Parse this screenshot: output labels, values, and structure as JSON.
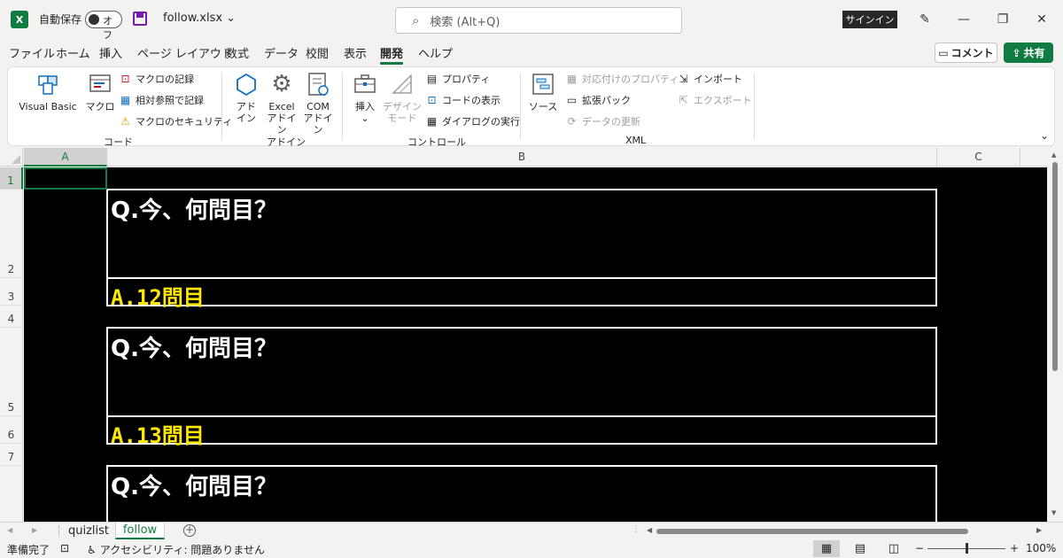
{
  "title": {
    "autosave_label": "自動保存",
    "autosave_state": "オフ",
    "filename": "follow.xlsx",
    "search_placeholder": "検索 (Alt+Q)",
    "signin": "サインイン"
  },
  "menu": {
    "tabs": [
      "ファイル",
      "ホーム",
      "挿入",
      "ページ レイアウト",
      "数式",
      "データ",
      "校閲",
      "表示",
      "開発",
      "ヘルプ"
    ],
    "active_tab": "開発",
    "comment": "コメント",
    "share": "共有"
  },
  "ribbon": {
    "code": {
      "label": "コード",
      "visual_basic": "Visual Basic",
      "macro": "マクロ",
      "record_macro": "マクロの記録",
      "relative_ref": "相対参照で記録",
      "macro_security": "マクロのセキュリティ"
    },
    "addins": {
      "label": "アドイン",
      "addin_line1": "アド",
      "addin_line2": "イン",
      "excel_line1": "Excel",
      "excel_line2": "アドイン",
      "com_line1": "COM",
      "com_line2": "アドイン"
    },
    "controls": {
      "label": "コントロール",
      "insert": "挿入",
      "design_line1": "デザイン",
      "design_line2": "モード",
      "properties": "プロパティ",
      "view_code": "コードの表示",
      "run_dialog": "ダイアログの実行"
    },
    "xml": {
      "label": "XML",
      "source": "ソース",
      "map_properties": "対応付けのプロパティ",
      "expansion_packs": "拡張パック",
      "refresh_data": "データの更新",
      "import": "インポート",
      "export": "エクスポート"
    }
  },
  "grid": {
    "columns": [
      "A",
      "B",
      "C"
    ],
    "rows": [
      "1",
      "2",
      "3",
      "4",
      "5",
      "6",
      "7"
    ],
    "cells": {
      "q1": "Q.今、何問目？",
      "a1": "A.12問目",
      "q2": "Q.今、何問目？",
      "a2": "A.13問目",
      "q3": "Q.今、何問目？"
    },
    "colors": {
      "background": "#000000",
      "question": "#ffffff",
      "answer": "#ffe800",
      "accent": "#107c41"
    }
  },
  "sheets": {
    "tabs": [
      "quizlist",
      "follow"
    ],
    "active": "follow"
  },
  "status": {
    "ready": "準備完了",
    "accessibility": "アクセシビリティ: 問題ありません",
    "zoom": "100%"
  }
}
